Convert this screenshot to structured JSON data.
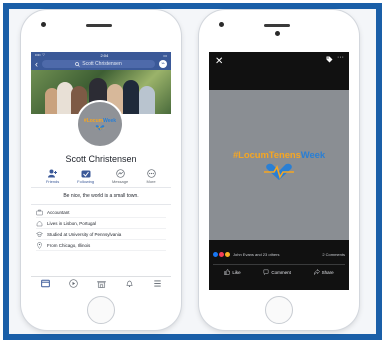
{
  "left_phone": {
    "status": {
      "carrier": "•••• ⌔",
      "time": "2:04"
    },
    "nav": {
      "search_text": "Scott Christensen"
    },
    "profile": {
      "name": "Scott Christensen",
      "avatar_hashtag_part1": "#Locum",
      "avatar_hashtag_part2": "Week",
      "bio": "Be nice, the world is a small town."
    },
    "actions": [
      {
        "label": "Friends"
      },
      {
        "label": "Following"
      },
      {
        "label": "Message"
      },
      {
        "label": "More"
      }
    ],
    "info": [
      {
        "text": "Accountant",
        "icon": "briefcase-icon"
      },
      {
        "text": "Lives in Lisbon, Portugal",
        "icon": "home-icon"
      },
      {
        "text": "Studied at University of Pennsylvania",
        "icon": "education-icon"
      },
      {
        "text": "From Chicago, Illinois",
        "icon": "location-icon"
      }
    ],
    "tabs": [
      "home-icon",
      "video-icon",
      "marketplace-icon",
      "bell-icon",
      "menu-icon"
    ]
  },
  "right_phone": {
    "hashtag_part1": "#LocumTenens",
    "hashtag_part2": "Week",
    "reactions_text": "John Evans and 23 others",
    "comments_text": "2 Comments",
    "buttons": [
      {
        "label": "Like"
      },
      {
        "label": "Comment"
      },
      {
        "label": "Share"
      }
    ]
  },
  "colors": {
    "frame": "#1a5fa8",
    "facebook_blue": "#3b5998",
    "accent_orange": "#f5a623",
    "accent_blue": "#2a7fd4"
  }
}
